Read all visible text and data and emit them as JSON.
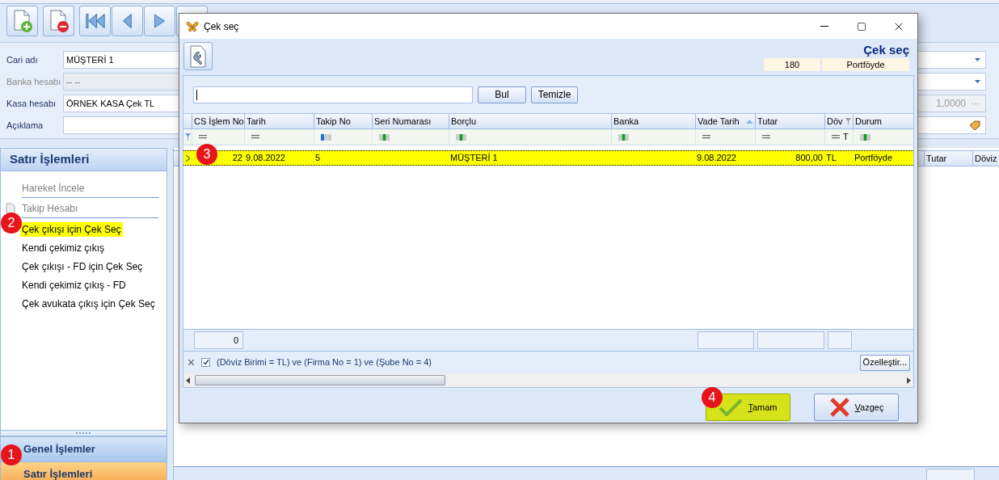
{
  "form": {
    "fields": [
      {
        "label": "Cari adı",
        "value": "MÜŞTERİ 1",
        "disabled": false
      },
      {
        "label": "Banka hesabı",
        "value": "-- --",
        "disabled": true
      },
      {
        "label": "Kasa hesabı",
        "value": "ÖRNEK KASA Çek TL",
        "disabled": false
      },
      {
        "label": "Açıklama",
        "disabled": false
      }
    ],
    "right_fields": [
      {
        "kind": "dropdown"
      },
      {
        "kind": "dropdown"
      },
      {
        "kind": "number",
        "value": "1,0000",
        "button": "···"
      },
      {
        "kind": "tag"
      }
    ]
  },
  "side_panel": {
    "title": "Satır İşlemleri",
    "items": [
      {
        "label": "Hareket İncele",
        "disabled": true,
        "selected": false,
        "divider": true
      },
      {
        "label": "Takip Hesabı",
        "disabled": true,
        "selected": false,
        "divider": true
      },
      {
        "label": "Çek çıkışı için Çek Seç",
        "disabled": false,
        "selected": true,
        "divider": false
      },
      {
        "label": "Kendi çekimiz çıkış",
        "disabled": false,
        "selected": false,
        "divider": false
      },
      {
        "label": "Çek çıkışı - FD için Çek Seç",
        "disabled": false,
        "selected": false,
        "divider": false
      },
      {
        "label": "Kendi çekimiz çıkış - FD",
        "disabled": false,
        "selected": false,
        "divider": false
      },
      {
        "label": "Çek avukata çıkış için Çek Seç",
        "disabled": false,
        "selected": false,
        "divider": false
      }
    ],
    "nav": [
      {
        "label": "Genel İşlemler",
        "selected": false
      },
      {
        "label": "Satır İşlemleri",
        "selected": true
      }
    ]
  },
  "background_grid": {
    "columns": [
      "Tutar",
      "Döviz"
    ]
  },
  "dialog": {
    "title": "Çek seç",
    "heading": "Çek seç",
    "info": [
      "180",
      "Portföyde"
    ],
    "search_buttons": [
      "Bul",
      "Temizle"
    ],
    "columns": [
      {
        "label": "CS İşlem No",
        "kind": "equals",
        "sorted": false,
        "filtered": false
      },
      {
        "label": "Tarih",
        "kind": "equals",
        "sorted": false,
        "filtered": false
      },
      {
        "label": "Takip No",
        "kind": "text_first",
        "sorted": false,
        "filtered": false
      },
      {
        "label": "Seri Numarası",
        "kind": "text",
        "sorted": false,
        "filtered": false
      },
      {
        "label": "Borçlu",
        "kind": "text",
        "sorted": false,
        "filtered": false
      },
      {
        "label": "Banka",
        "kind": "text",
        "sorted": false,
        "filtered": false
      },
      {
        "label": "Vade Tarih",
        "kind": "equals",
        "sorted": true,
        "filtered": false
      },
      {
        "label": "Tutar",
        "kind": "equals",
        "sorted": false,
        "filtered": false
      },
      {
        "label": "Döv",
        "kind": "equals",
        "filter_value": "T",
        "sorted": false,
        "filtered": true
      },
      {
        "label": "Durum",
        "kind": "text",
        "sorted": false,
        "filtered": false
      }
    ],
    "rows": [
      {
        "cells": [
          "22",
          "9.08.2022",
          "5",
          null,
          "MÜŞTERİ 1",
          null,
          "9.08.2022",
          "800,00",
          "TL",
          "Portföyde"
        ],
        "selected": true,
        "highlighted": true
      }
    ],
    "footer_count": "0",
    "filter": {
      "checked": true,
      "text": "(Döviz Birimi = TL) ve (Firma No = 1) ve (Şube No = 4)",
      "button": "Özelleştir..."
    },
    "buttons": [
      {
        "label": "Tamam",
        "kind": "ok",
        "highlighted": true
      },
      {
        "label": "Vazgeç",
        "kind": "cancel",
        "highlighted": false
      }
    ]
  },
  "markers": [
    "1",
    "2",
    "3",
    "4"
  ]
}
